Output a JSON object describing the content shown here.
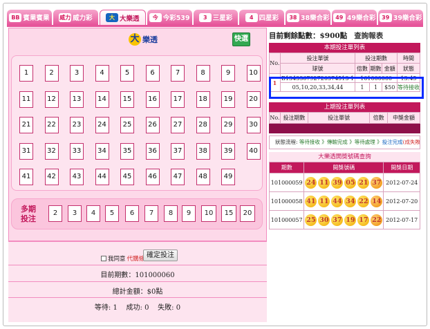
{
  "tabs": [
    {
      "icon": "BB",
      "label": "賓果賓果",
      "active": false
    },
    {
      "icon": "威力",
      "label": "威力彩",
      "active": false
    },
    {
      "icon": "大",
      "label": "大樂透",
      "active": true
    },
    {
      "icon": "今",
      "label": "今彩539",
      "active": false
    },
    {
      "icon": "3",
      "label": "三星彩",
      "active": false
    },
    {
      "icon": "4",
      "label": "四星彩",
      "active": false
    },
    {
      "icon": "38",
      "label": "38樂合彩",
      "active": false
    },
    {
      "icon": "49",
      "label": "49樂合彩",
      "active": false
    },
    {
      "icon": "39",
      "label": "39樂合彩",
      "active": false
    }
  ],
  "left": {
    "logo_text": "樂透",
    "logo_char": "大",
    "quick_pick": "快選",
    "numbers": [
      "1",
      "2",
      "3",
      "4",
      "5",
      "6",
      "7",
      "8",
      "9",
      "10",
      "11",
      "12",
      "13",
      "14",
      "15",
      "16",
      "17",
      "18",
      "19",
      "20",
      "21",
      "22",
      "23",
      "24",
      "25",
      "26",
      "27",
      "28",
      "29",
      "30",
      "31",
      "32",
      "33",
      "34",
      "35",
      "36",
      "37",
      "38",
      "39",
      "40",
      "41",
      "42",
      "43",
      "44",
      "45",
      "46",
      "47",
      "48",
      "49"
    ],
    "multi_label": "多期投注",
    "multi_numbers": [
      "2",
      "3",
      "4",
      "5",
      "6",
      "7",
      "8",
      "9",
      "10",
      "15",
      "20"
    ],
    "agree_text": "我同意",
    "agree_red": "代購條款",
    "confirm_label": "確定投注",
    "current_period": "目前期數：101000060",
    "total_amount": "總計金額：$0點",
    "status_line": "等待: 1    成功: 0    失敗: 0"
  },
  "right": {
    "balance": "目前剩餘點數：$900點",
    "query_link": "查詢報表",
    "current_header": "本期投注單列表",
    "cur_cols": {
      "no": "No.",
      "ticket": "投注單號",
      "period": "投注期數",
      "time": "時間",
      "balls": "球號",
      "multiple": "倍數",
      "periods": "期數",
      "amount": "金額",
      "status": "狀態"
    },
    "cur_row": {
      "no": "1",
      "ticket": "B134336792720374513 1",
      "period": "101000060",
      "time": "13:45",
      "balls": "05,10,20,33,34,44",
      "multiple": "1",
      "periods": "1",
      "amount": "$50",
      "status": "等待接收"
    },
    "last_header": "上期投注單列表",
    "last_cols": [
      "No.",
      "投注期數",
      "投注單號",
      "倍數",
      "中獎金額"
    ],
    "flow": [
      {
        "text": "狀態流程: ",
        "color": "#333"
      },
      {
        "text": "等待接收 》",
        "color": "#2e7d32"
      },
      {
        "text": "傳輸完成 》",
        "color": "#2e7d32"
      },
      {
        "text": "等待處理 》",
        "color": "#2e7d32"
      },
      {
        "text": "投注完成",
        "color": "#1565c0"
      },
      {
        "text": "(成失敗)",
        "color": "#d32f2f"
      }
    ],
    "draw_header": "大樂透開獎號碼查詢",
    "draw_cols": [
      "期數",
      "開獎號碼",
      "開獎日期"
    ],
    "draws": [
      {
        "period": "101000059",
        "balls": [
          "24",
          "11",
          "39",
          "05",
          "21"
        ],
        "special": "37",
        "date": "2012-07-24"
      },
      {
        "period": "101000058",
        "balls": [
          "41",
          "11",
          "44",
          "34",
          "22"
        ],
        "special": "14",
        "date": "2012-07-20"
      },
      {
        "period": "101000057",
        "balls": [
          "25",
          "30",
          "37",
          "19",
          "17"
        ],
        "special": "22",
        "date": "2012-07-17"
      }
    ]
  }
}
